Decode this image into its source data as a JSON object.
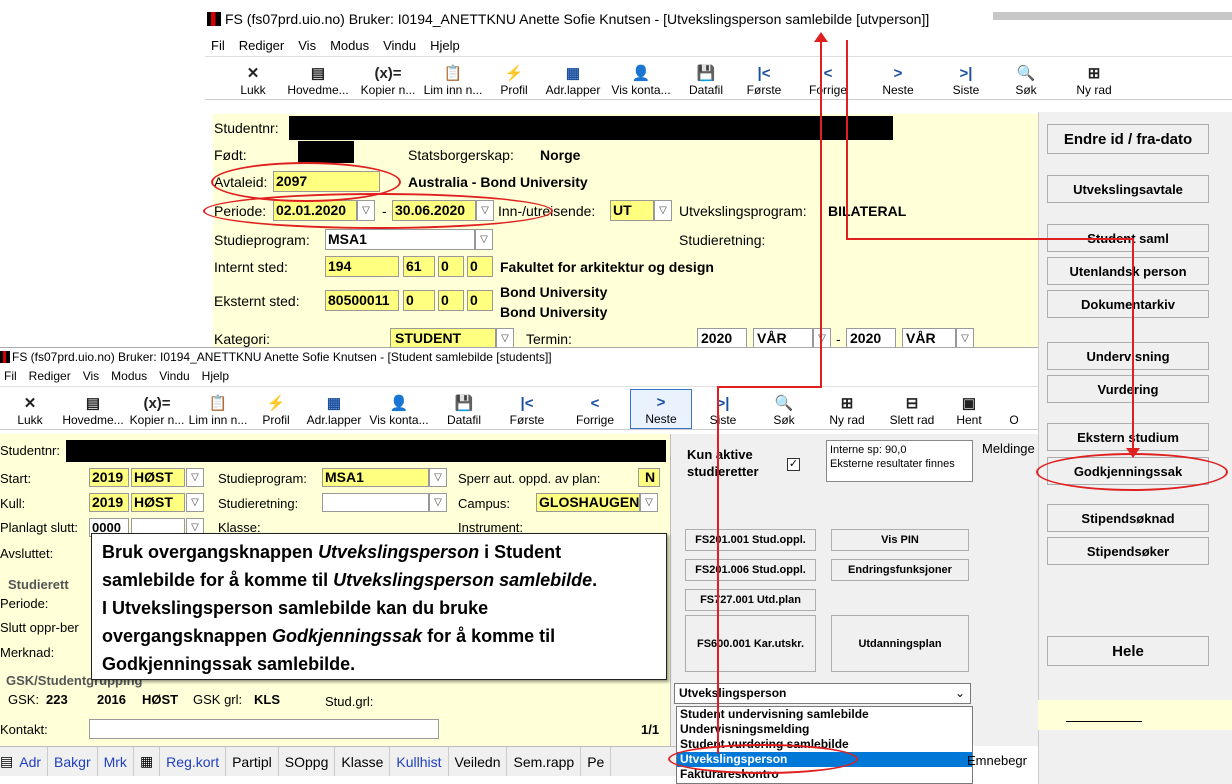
{
  "win1": {
    "title": "FS (fs07prd.uio.no) Bruker: I0194_ANETTKNU Anette Sofie Knutsen - [Utvekslingsperson samlebilde [utvperson]]",
    "menu": [
      "Fil",
      "Rediger",
      "Vis",
      "Modus",
      "Vindu",
      "Hjelp"
    ],
    "toolbar": [
      {
        "label": "Lukk",
        "icon": "✕"
      },
      {
        "label": "Hovedme...",
        "icon": "▤"
      },
      {
        "label": "Kopier n...",
        "icon": "(x)="
      },
      {
        "label": "Lim inn n...",
        "icon": "📋"
      },
      {
        "label": "Profil",
        "icon": "⚡"
      },
      {
        "label": "Adr.lapper",
        "icon": "▦"
      },
      {
        "label": "Vis konta...",
        "icon": "👤"
      },
      {
        "label": "Datafil",
        "icon": "💾"
      },
      {
        "label": "Første",
        "icon": "|<"
      },
      {
        "label": "Forrige",
        "icon": "<"
      },
      {
        "label": "Neste",
        "icon": ">"
      },
      {
        "label": "Siste",
        "icon": ">|"
      },
      {
        "label": "Søk",
        "icon": "🔍"
      },
      {
        "label": "Ny rad",
        "icon": "⊞"
      }
    ],
    "form": {
      "studentnr_label": "Studentnr:",
      "fodt_label": "Født:",
      "statsborgerskap_label": "Statsborgerskap:",
      "statsborgerskap_value": "Norge",
      "avtaleid_label": "Avtaleid:",
      "avtaleid_value": "2097",
      "avtale_name": "Australia - Bond University",
      "periode_label": "Periode:",
      "periode_from": "02.01.2020",
      "periode_dash": "-",
      "periode_to": "30.06.2020",
      "inn_ut_label": "Inn-/utreisende:",
      "inn_ut_value": "UT",
      "utvekslingsprogram_label": "Utvekslingsprogram:",
      "utvekslingsprogram_value": "BILATERAL",
      "studieprogram_label": "Studieprogram:",
      "studieprogram_value": "MSA1",
      "studieretning_label": "Studieretning:",
      "internt_sted_label": "Internt sted:",
      "internt_sted_values": [
        "194",
        "61",
        "0",
        "0"
      ],
      "internt_sted_name": "Fakultet for arkitektur og design",
      "eksternt_sted_label": "Eksternt sted:",
      "eksternt_sted_values": [
        "80500011",
        "0",
        "0",
        "0"
      ],
      "eksternt_sted_name1": "Bond University",
      "eksternt_sted_name2": "Bond University",
      "kategori_label": "Kategori:",
      "kategori_value": "STUDENT",
      "termin_label": "Termin:",
      "termin_from_year": "2020",
      "termin_from_sem": "VÅR",
      "termin_to_year": "2020",
      "termin_to_sem": "VÅR"
    },
    "side_buttons": [
      "Endre id / fra-dato",
      "Utvekslingsavtale",
      "Student saml",
      "Utenlandsk person",
      "Dokumentarkiv",
      "Undervisning",
      "Vurdering",
      "Ekstern studium",
      "Godkjenningssak",
      "Stipendsøknad",
      "Stipendsøker",
      "Hele"
    ]
  },
  "win2": {
    "title": "FS (fs07prd.uio.no) Bruker: I0194_ANETTKNU Anette Sofie Knutsen - [Student samlebilde [students]]",
    "menu": [
      "Fil",
      "Rediger",
      "Vis",
      "Modus",
      "Vindu",
      "Hjelp"
    ],
    "toolbar": [
      {
        "label": "Lukk",
        "icon": "✕"
      },
      {
        "label": "Hovedme...",
        "icon": "▤"
      },
      {
        "label": "Kopier n...",
        "icon": "(x)="
      },
      {
        "label": "Lim inn n...",
        "icon": "📋"
      },
      {
        "label": "Profil",
        "icon": "⚡"
      },
      {
        "label": "Adr.lapper",
        "icon": "▦"
      },
      {
        "label": "Vis konta...",
        "icon": "👤"
      },
      {
        "label": "Datafil",
        "icon": "💾"
      },
      {
        "label": "Første",
        "icon": "|<"
      },
      {
        "label": "Forrige",
        "icon": "<"
      },
      {
        "label": "Neste",
        "icon": ">"
      },
      {
        "label": "Siste",
        "icon": ">|"
      },
      {
        "label": "Søk",
        "icon": "🔍"
      },
      {
        "label": "Ny rad",
        "icon": "⊞"
      },
      {
        "label": "Slett rad",
        "icon": "⊟"
      },
      {
        "label": "Hent",
        "icon": "▣"
      },
      {
        "label": "O",
        "icon": ""
      }
    ],
    "form": {
      "studentnr_label": "Studentnr:",
      "start_label": "Start:",
      "start_year": "2019",
      "start_sem": "HØST",
      "studieprogram_label": "Studieprogram:",
      "studieprogram_value": "MSA1",
      "sperr_label": "Sperr aut. oppd. av plan:",
      "sperr_value": "N",
      "kull_label": "Kull:",
      "kull_year": "2019",
      "kull_sem": "HØST",
      "studieretning_label": "Studieretning:",
      "campus_label": "Campus:",
      "campus_value": "GLOSHAUGEN",
      "planlagt_label": "Planlagt slutt:",
      "planlagt_value": "0000",
      "klasse_label": "Klasse:",
      "instrument_label": "Instrument:",
      "avsluttet_label": "Avsluttet:",
      "studierett_label": "Studierett",
      "periode_label": "Periode:",
      "slutt_label": "Slutt oppr-ber",
      "merknad_label": "Merknad:",
      "gsk_group_label": "GSK/Studentgrupping",
      "gsk_label": "GSK:",
      "gsk_value": "223",
      "gsk_year": "2016",
      "gsk_sem": "HØST",
      "gsk_grl_label": "GSK grl:",
      "gsk_grl_value": "KLS",
      "stud_grl_label": "Stud.grl:",
      "kontakt_label": "Kontakt:",
      "page_count": "1/1"
    },
    "right": {
      "kun_aktive": "Kun aktive studieretter",
      "info_line1": "Interne sp: 90,0",
      "info_line2": "Eksterne resultater finnes",
      "meldinger": "Meldinge",
      "buttons": [
        "FS201.001 Stud.oppl.",
        "Vis PIN",
        "FS201.006 Stud.oppl.",
        "Endringsfunksjoner",
        "FS727.001 Utd.plan",
        "FS600.001 Kar.utskr.",
        "Utdanningsplan"
      ],
      "dropdown_value": "Utvekslingsperson",
      "dropdown_options": [
        "Student undervisning samlebilde",
        "Undervisningsmelding",
        "Student vurdering samlebilde",
        "Utvekslingsperson",
        "Fakturareskontro"
      ],
      "selected_index": 3
    },
    "bottom_tabs": [
      "Adr",
      "Bakgr",
      "Mrk",
      "▦",
      "Reg.kort",
      "Partipl",
      "SOppg",
      "Klasse",
      "Kullhist",
      "Veiledn",
      "Sem.rapp",
      "Pe"
    ],
    "bottom_right": "Emnebegr"
  },
  "callout": {
    "line1_a": "Bruk overgangsknappen ",
    "line1_i": "Utvekslingsperson",
    "line1_b": " i Student",
    "line2_a": "samlebilde for å komme til ",
    "line2_i": "Utvekslingsperson samlebilde",
    "line2_b": ".",
    "line3": "I Utvekslingsperson samlebilde kan du bruke",
    "line4_a": "overgangsknappen ",
    "line4_i": "Godkjenningssak",
    "line4_b": " for å komme til",
    "line5": "Godkjenningssak samlebilde."
  },
  "colors": {
    "accent_red": "#e02020",
    "form_bg": "#ffffd8",
    "field_yellow": "#ffff80",
    "selection_blue": "#0078d7"
  }
}
